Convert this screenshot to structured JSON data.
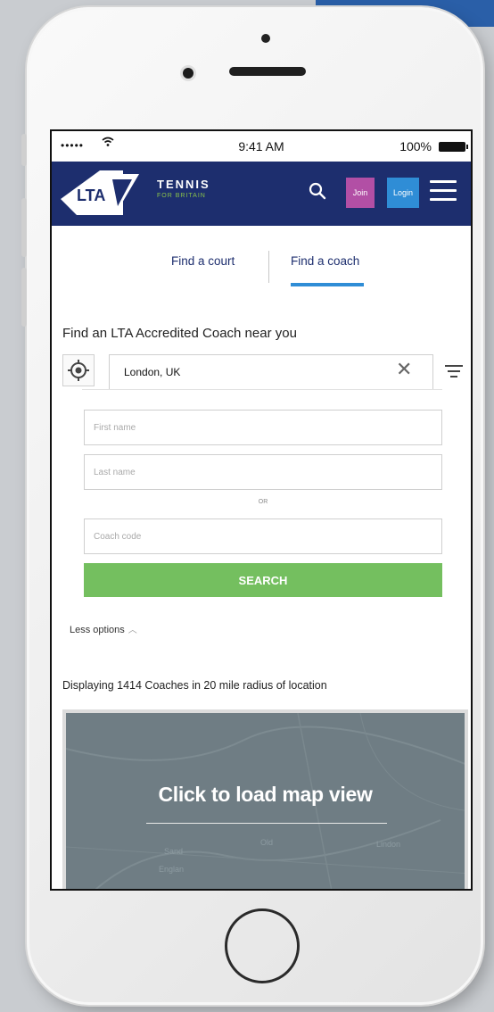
{
  "status_bar": {
    "signal": "•••••",
    "wifi_icon": "wifi-icon",
    "time": "9:41 AM",
    "battery": "100%"
  },
  "nav": {
    "logo_text": "LTA",
    "brand_line1": "TENNIS",
    "brand_line2": "FOR BRITAIN",
    "join_label": "Join",
    "login_label": "Login",
    "colors": {
      "navbar": "#1d2e6e",
      "join": "#b24fa5",
      "login": "#2f8dd6",
      "brand_accent": "#8ac24a"
    }
  },
  "tabs": [
    {
      "label": "Find a court",
      "active": false
    },
    {
      "label": "Find a coach",
      "active": true
    }
  ],
  "search": {
    "heading": "Find an LTA Accredited Coach near you",
    "location_value": "London, UK",
    "first_name_placeholder": "First name",
    "last_name_placeholder": "Last name",
    "or_label": "OR",
    "coach_code_placeholder": "Coach code",
    "button_label": "SEARCH",
    "button_color": "#74bf5f",
    "less_options_label": "Less options"
  },
  "results": {
    "summary": "Displaying 1414 Coaches in 20 mile radius of location"
  },
  "map": {
    "cta": "Click to load map view",
    "labels": [
      "Sand",
      "Englan",
      "Old",
      "Lindon"
    ]
  }
}
